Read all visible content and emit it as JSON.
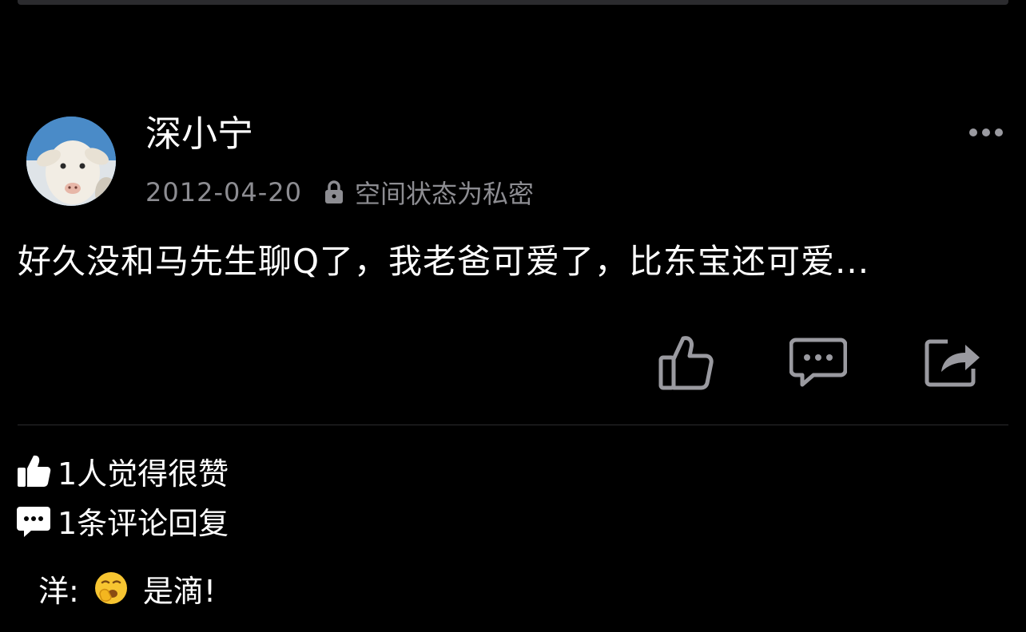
{
  "post": {
    "author": "深小宁",
    "date": "2012-04-20",
    "privacy": "空间状态为私密",
    "content": "好久没和马先生聊Q了，我老爸可爱了，比东宝还可爱..."
  },
  "icons": {
    "avatar": "goat-avatar",
    "privacy": "lock-icon",
    "more": "ellipsis-icon",
    "like": "thumbs-up-icon",
    "comment": "comment-bubble-icon",
    "share": "share-icon",
    "comment_emoji": "yawning-face-emoji"
  },
  "stats": {
    "likes": "1人觉得很赞",
    "comments": "1条评论回复"
  },
  "comments": [
    {
      "author": "洋:",
      "text": "是滴!"
    }
  ],
  "colors": {
    "background": "#000000",
    "text": "#ffffff",
    "meta": "#8d8d92",
    "icon": "#9a9aa0",
    "divider": "#2c2c2e"
  }
}
